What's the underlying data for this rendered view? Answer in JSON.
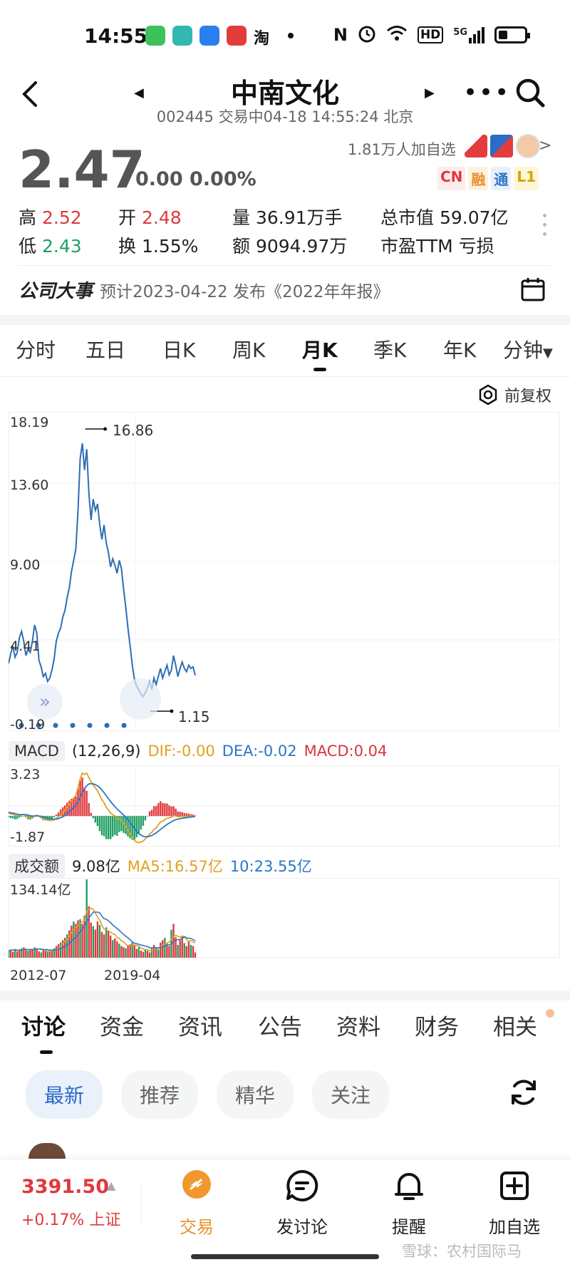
{
  "status_bar": {
    "time": "14:55",
    "apps": [
      "BOSS直聘",
      "淘"
    ],
    "network": "5G",
    "hd": "HD",
    "nfc": "N"
  },
  "header": {
    "title": "中南文化",
    "subtitle": "002445 交易中04-18 14:55:24 北京"
  },
  "quote": {
    "price": "2.47",
    "change": "0.00 0.00%",
    "followers": "1.81万人加自选",
    "tags": [
      "CN",
      "融",
      "通",
      "L1"
    ],
    "colors": {
      "up": "#e0393e",
      "down": "#1e9f63",
      "neutral": "#555555",
      "accent": "#e8912d",
      "link": "#2a6cc8"
    },
    "stats": {
      "high_label": "高",
      "high": "2.52",
      "low_label": "低",
      "low": "2.43",
      "open_label": "开",
      "open": "2.48",
      "turnover_label": "换",
      "turnover": "1.55%",
      "volume_label": "量",
      "volume": "36.91万手",
      "amount_label": "额",
      "amount": "9094.97万",
      "mktcap_label": "总市值",
      "mktcap": "59.07亿",
      "pe_label": "市盈TTM",
      "pe": "亏损"
    }
  },
  "event": {
    "title": "公司大事",
    "desc": "预计2023-04-22 发布《2022年年报》"
  },
  "k_tabs": [
    "分时",
    "五日",
    "日K",
    "周K",
    "月K",
    "季K",
    "年K",
    "分钟"
  ],
  "k_tab_active": "月K",
  "adjust_label": "前复权",
  "chart_data": [
    {
      "type": "line",
      "title": "",
      "yticks": [
        "18.19",
        "13.60",
        "9.00",
        "4.41",
        "-0.19"
      ],
      "ylim": [
        -0.19,
        18.19
      ],
      "max_label": "16.86",
      "min_label": "1.15",
      "series": [
        {
          "values": [
            3.2,
            3.8,
            4.3,
            3.6,
            3.9,
            4.8,
            5.2,
            4.6,
            3.7,
            4.1,
            3.9,
            4.6,
            5.6,
            5.1,
            3.4,
            3.0,
            2.4,
            2.6,
            2.1,
            2.3,
            2.8,
            3.5,
            4.6,
            5.1,
            5.4,
            6.1,
            6.5,
            7.3,
            7.9,
            8.9,
            9.6,
            10.3,
            12.7,
            15.9,
            16.86,
            15.2,
            16.5,
            13.8,
            12.1,
            13.4,
            12.7,
            13.1,
            11.8,
            10.9,
            11.8,
            10.7,
            10.1,
            9.2,
            9.7,
            9.3,
            8.8,
            9.6,
            9.1,
            7.8,
            6.7,
            5.4,
            4.3,
            3.1,
            2.2,
            1.8,
            1.6,
            1.3,
            1.15,
            1.4,
            1.7,
            2.1,
            1.6,
            2.3,
            1.9,
            2.4,
            2.9,
            2.3,
            2.7,
            3.1,
            2.5,
            2.8,
            3.7,
            3.1,
            2.4,
            2.9,
            3.3,
            2.9,
            2.7,
            3.1,
            2.9,
            3.0,
            2.47
          ]
        }
      ]
    },
    {
      "type": "bar",
      "title": "MACD",
      "params": "(12,26,9)",
      "dif_label": "DIF:-0.00",
      "dea_label": "DEA:-0.02",
      "macd_label": "MACD:0.04",
      "ylim": [
        -1.87,
        3.23
      ],
      "yticks": [
        "3.23",
        "-1.87"
      ],
      "series": [
        {
          "name": "DIF",
          "values": [
            0.2,
            0.15,
            0.12,
            0.05,
            0.02,
            0.05,
            0.08,
            0.1,
            0.05,
            -0.05,
            -0.1,
            -0.08,
            0.0,
            0.05,
            -0.02,
            -0.1,
            -0.2,
            -0.25,
            -0.28,
            -0.3,
            -0.3,
            -0.25,
            -0.15,
            -0.05,
            0.1,
            0.25,
            0.4,
            0.6,
            0.8,
            1.0,
            1.2,
            1.4,
            1.9,
            2.5,
            2.9,
            2.8,
            2.9,
            2.6,
            2.3,
            2.1,
            1.9,
            1.7,
            1.4,
            1.1,
            0.9,
            0.6,
            0.4,
            0.2,
            0.1,
            0.0,
            -0.2,
            -0.2,
            -0.3,
            -0.5,
            -0.7,
            -0.95,
            -1.2,
            -1.45,
            -1.65,
            -1.75,
            -1.8,
            -1.75,
            -1.7,
            -1.55,
            -1.4,
            -1.2,
            -1.1,
            -0.9,
            -0.8,
            -0.6,
            -0.4,
            -0.35,
            -0.25,
            -0.15,
            -0.12,
            -0.08,
            0.02,
            0.0,
            -0.05,
            -0.04,
            -0.02,
            -0.03,
            -0.02,
            -0.01,
            -0.01,
            0.0,
            0.0
          ]
        },
        {
          "name": "DEA",
          "values": [
            0.25,
            0.22,
            0.2,
            0.16,
            0.12,
            0.1,
            0.1,
            0.1,
            0.09,
            0.06,
            0.02,
            0.0,
            0.0,
            0.01,
            0.0,
            -0.02,
            -0.06,
            -0.1,
            -0.14,
            -0.17,
            -0.2,
            -0.21,
            -0.2,
            -0.17,
            -0.12,
            -0.05,
            0.04,
            0.15,
            0.28,
            0.42,
            0.58,
            0.74,
            0.97,
            1.28,
            1.6,
            1.84,
            2.05,
            2.16,
            2.19,
            2.17,
            2.12,
            2.04,
            1.91,
            1.75,
            1.58,
            1.38,
            1.18,
            0.98,
            0.8,
            0.64,
            0.47,
            0.34,
            0.21,
            0.07,
            -0.09,
            -0.26,
            -0.45,
            -0.65,
            -0.85,
            -1.03,
            -1.18,
            -1.29,
            -1.37,
            -1.4,
            -1.4,
            -1.36,
            -1.31,
            -1.23,
            -1.14,
            -1.03,
            -0.9,
            -0.79,
            -0.68,
            -0.57,
            -0.48,
            -0.4,
            -0.31,
            -0.25,
            -0.21,
            -0.18,
            -0.15,
            -0.13,
            -0.11,
            -0.09,
            -0.07,
            -0.05,
            -0.02
          ]
        }
      ]
    },
    {
      "type": "bar",
      "title": "成交额",
      "value_label": "9.08亿",
      "ma5_label": "MA5:16.57亿",
      "ma10_label": "10:23.55亿",
      "ytick": "134.14亿",
      "ylim": [
        0,
        134.14
      ],
      "xticks": [
        "2012-07",
        "2019-04"
      ],
      "values": [
        12,
        14,
        10,
        15,
        11,
        13,
        16,
        18,
        13,
        12,
        15,
        14,
        18,
        16,
        11,
        9,
        13,
        12,
        10,
        11,
        14,
        16,
        20,
        23,
        26,
        30,
        34,
        40,
        47,
        55,
        62,
        58,
        64,
        66,
        58,
        72,
        134.14,
        88,
        60,
        54,
        48,
        62,
        56,
        44,
        40,
        52,
        46,
        38,
        30,
        33,
        28,
        24,
        20,
        18,
        16,
        20,
        23,
        26,
        22,
        15,
        18,
        12,
        10,
        14,
        12,
        9,
        16,
        22,
        18,
        14,
        26,
        30,
        34,
        24,
        20,
        48,
        58,
        35,
        22,
        30,
        38,
        25,
        20,
        28,
        22,
        20,
        9.08
      ],
      "ma5": [
        12,
        13,
        13,
        14,
        13,
        13,
        14,
        15,
        15,
        14,
        14,
        14,
        15,
        15,
        15,
        14,
        14,
        13,
        11,
        11,
        12,
        13,
        15,
        17,
        20,
        24,
        28,
        32,
        37,
        43,
        48,
        52,
        55,
        59,
        61,
        64,
        79,
        83,
        85,
        83,
        76,
        70,
        64,
        56,
        49,
        48,
        46,
        44,
        41,
        40,
        35,
        33,
        29,
        27,
        23,
        21,
        21,
        22,
        22,
        21,
        20,
        17,
        15,
        14,
        14,
        12,
        12,
        15,
        16,
        16,
        18,
        22,
        24,
        25,
        27,
        31,
        36,
        38,
        37,
        35,
        37,
        36,
        31,
        28,
        29,
        27,
        26
      ],
      "ma10": [
        12,
        13,
        13,
        13,
        13,
        13,
        13,
        14,
        14,
        14,
        14,
        14,
        14,
        15,
        15,
        15,
        14,
        14,
        14,
        13,
        13,
        13,
        14,
        15,
        16,
        17,
        20,
        22,
        24,
        29,
        32,
        35,
        40,
        44,
        49,
        54,
        62,
        68,
        73,
        78,
        78,
        78,
        77,
        71,
        67,
        66,
        63,
        60,
        56,
        53,
        50,
        47,
        43,
        40,
        37,
        34,
        31,
        27,
        25,
        24,
        23,
        22,
        21,
        20,
        19,
        17,
        17,
        17,
        17,
        17,
        17,
        18,
        20,
        22,
        22,
        24,
        28,
        30,
        31,
        31,
        33,
        36,
        34,
        33,
        33,
        31,
        29
      ]
    }
  ],
  "lower_tabs": [
    "讨论",
    "资金",
    "资讯",
    "公告",
    "资料",
    "财务",
    "相关"
  ],
  "lower_tab_active": "讨论",
  "filters": [
    "最新",
    "推荐",
    "精华",
    "关注"
  ],
  "filter_active": "最新",
  "bottom_bar": {
    "index_value": "3391.50",
    "index_change": "+0.17% 上证",
    "trade_label": "交易",
    "discuss_label": "发讨论",
    "remind_label": "提醒",
    "add_label": "加自选"
  },
  "watermark": "雪球：农村国际马"
}
